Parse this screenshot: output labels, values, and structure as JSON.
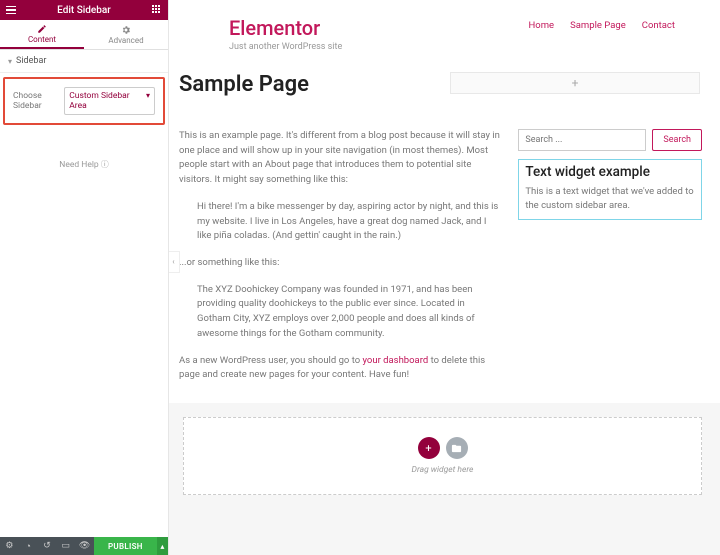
{
  "panel": {
    "title": "Edit Sidebar",
    "tabs": {
      "content": "Content",
      "advanced": "Advanced"
    },
    "section": "Sidebar",
    "choose_label": "Choose Sidebar",
    "choose_value": "Custom Sidebar Area",
    "help": "Need Help",
    "publish": "PUBLISH"
  },
  "site": {
    "brand": "Elementor",
    "tagline": "Just another WordPress site",
    "nav": {
      "home": "Home",
      "sample": "Sample Page",
      "contact": "Contact"
    }
  },
  "page": {
    "title": "Sample Page",
    "p1": "This is an example page. It's different from a blog post because it will stay in one place and will show up in your site navigation (in most themes). Most people start with an About page that introduces them to potential site visitors. It might say something like this:",
    "q1": "Hi there! I'm a bike messenger by day, aspiring actor by night, and this is my website. I live in Los Angeles, have a great dog named Jack, and I like piña coladas. (And gettin' caught in the rain.)",
    "p2": "...or something like this:",
    "q2": "The XYZ Doohickey Company was founded in 1971, and has been providing quality doohickeys to the public ever since. Located in Gotham City, XYZ employs over 2,000 people and does all kinds of awesome things for the Gotham community.",
    "p3a": "As a new WordPress user, you should go to ",
    "p3link": "your dashboard",
    "p3b": " to delete this page and create new pages for your content. Have fun!"
  },
  "sidebar": {
    "search_placeholder": "Search ...",
    "search_btn": "Search",
    "widget_title": "Text widget example",
    "widget_body": "This is a text widget that we've added to the custom sidebar area."
  },
  "dropzone": {
    "text": "Drag widget here"
  }
}
